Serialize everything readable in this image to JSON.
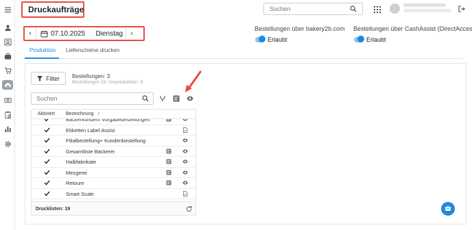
{
  "header": {
    "title": "Druckaufträge",
    "search_placeholder": "Suchen"
  },
  "date_nav": {
    "date": "07.10.2025",
    "weekday": "Dienstag"
  },
  "permissions": [
    {
      "label": "Bestellungen über bakery2b.com",
      "value": "Erlaubt"
    },
    {
      "label": "Bestellungen über CashAssist (DirectAccess)",
      "value": "Erlaubt"
    }
  ],
  "tabs": [
    {
      "label": "Produktion"
    },
    {
      "label": "Lieferscheine drucken"
    }
  ],
  "filter": {
    "button_label": "Filter",
    "orders_count": "Bestellungen: 3",
    "orders_pre_production": "Bestellungen für Vorproduktion: 0"
  },
  "list": {
    "search_placeholder": "Suchen",
    "columns": [
      "Aktiviert",
      "Bezeichnung"
    ],
    "sort_indicator": "↑",
    "rows": [
      {
        "name": "Bäckerkunden/ Vorgabebestellungen",
        "active": true,
        "icons": [
          "list",
          "view"
        ]
      },
      {
        "name": "Etiketten Label Assist",
        "active": true,
        "icons": [
          "document"
        ]
      },
      {
        "name": "Filialbestellung+ Kundenbestellung",
        "active": true,
        "icons": [
          "view"
        ]
      },
      {
        "name": "Gesamtliste Bäckerei",
        "active": true,
        "icons": [
          "list",
          "view"
        ]
      },
      {
        "name": "Halbfabrikate",
        "active": true,
        "icons": [
          "list",
          "view"
        ]
      },
      {
        "name": "Mezgerei",
        "active": true,
        "icons": [
          "list",
          "view"
        ]
      },
      {
        "name": "Retoure",
        "active": true,
        "icons": [
          "list",
          "view"
        ]
      },
      {
        "name": "Smart Scale",
        "active": true,
        "icons": [
          "document"
        ]
      }
    ],
    "footer": "Drucklisten: 19"
  },
  "colors": {
    "accent": "#1e88e5",
    "highlight": "#e74c3c"
  }
}
